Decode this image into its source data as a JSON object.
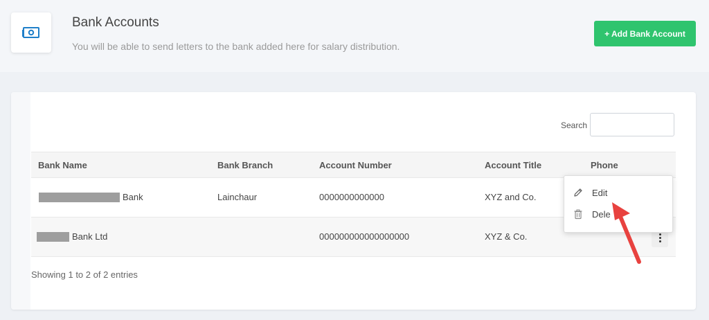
{
  "header": {
    "title": "Bank Accounts",
    "subtitle": "You will be able to send letters to the bank added here for salary distribution.",
    "icon": "money-bill-icon",
    "add_button_label": "+ Add Bank Account",
    "accent_color": "#2fc46e"
  },
  "search": {
    "label": "Search",
    "value": "",
    "placeholder": ""
  },
  "table": {
    "columns": [
      "Bank Name",
      "Bank Branch",
      "Account Number",
      "Account Title",
      "Phone"
    ],
    "rows": [
      {
        "bank_name": "Bank",
        "bank_branch": "Lainchaur",
        "account_number": "0000000000000",
        "account_title": "XYZ and Co.",
        "phone": ""
      },
      {
        "bank_name": "Bank Ltd",
        "bank_branch": "",
        "account_number": "000000000000000000",
        "account_title": "XYZ & Co.",
        "phone": ""
      }
    ]
  },
  "footer": {
    "info": "Showing 1 to 2 of 2 entries"
  },
  "dropdown": {
    "items": [
      {
        "label": "Edit",
        "icon": "pencil-icon"
      },
      {
        "label": "Dele",
        "icon": "trash-icon"
      }
    ]
  },
  "annotation": {
    "arrow_color": "#e8423f"
  }
}
